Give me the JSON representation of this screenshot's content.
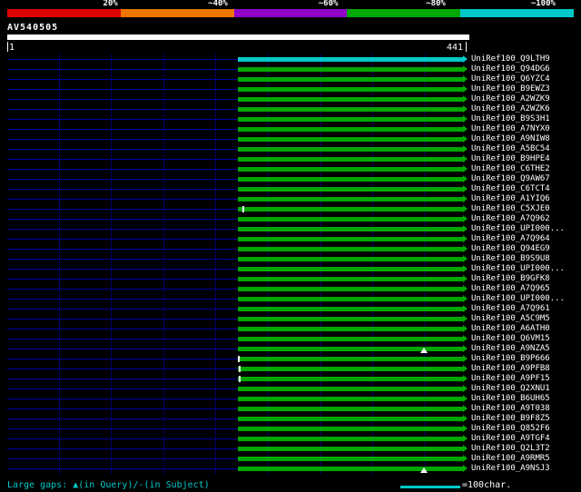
{
  "scale_bar": {
    "segments": [
      {
        "label": "20%",
        "color": "#dd0000"
      },
      {
        "label": "~40%",
        "color": "#ee7700"
      },
      {
        "label": "~60%",
        "color": "#9000c8"
      },
      {
        "label": "~80%",
        "color": "#00a800"
      },
      {
        "label": "~100%",
        "color": "#00c8c8"
      }
    ]
  },
  "query": {
    "name": "AV540505",
    "start_label": "1",
    "end_label": "441",
    "length": 441
  },
  "footer": {
    "legend": "Large gaps: ▲(in Query)/-(in Subject)",
    "scale_label": "=100char."
  },
  "chart_data": {
    "type": "bar",
    "orientation": "horizontal",
    "x_range": [
      1,
      441
    ],
    "x_start_label": "1",
    "x_end_label": "441",
    "query_name": "AV540505",
    "identity_legend": {
      "green": "~80%",
      "cyan": "~100%"
    },
    "hits": [
      {
        "name": "UniRef100_Q9LTH9",
        "start": 221,
        "end": 441,
        "color": "#00c8c8",
        "identity": "~100%"
      },
      {
        "name": "UniRef100_Q94DG6",
        "start": 221,
        "end": 441,
        "color": "#00a800",
        "identity": "~80%"
      },
      {
        "name": "UniRef100_Q6YZC4",
        "start": 221,
        "end": 441,
        "color": "#00a800",
        "identity": "~80%"
      },
      {
        "name": "UniRef100_B9EWZ3",
        "start": 221,
        "end": 441,
        "color": "#00a800",
        "identity": "~80%"
      },
      {
        "name": "UniRef100_A2WZK9",
        "start": 221,
        "end": 441,
        "color": "#00a800",
        "identity": "~80%"
      },
      {
        "name": "UniRef100_A2WZK6",
        "start": 221,
        "end": 441,
        "color": "#00a800",
        "identity": "~80%"
      },
      {
        "name": "UniRef100_B9S3H1",
        "start": 221,
        "end": 441,
        "color": "#00a800",
        "identity": "~80%"
      },
      {
        "name": "UniRef100_A7NYX0",
        "start": 221,
        "end": 441,
        "color": "#00a800",
        "identity": "~80%"
      },
      {
        "name": "UniRef100_A9NIW8",
        "start": 221,
        "end": 441,
        "color": "#00a800",
        "identity": "~80%"
      },
      {
        "name": "UniRef100_A5BC54",
        "start": 221,
        "end": 441,
        "color": "#00a800",
        "identity": "~80%"
      },
      {
        "name": "UniRef100_B9HPE4",
        "start": 221,
        "end": 441,
        "color": "#00a800",
        "identity": "~80%"
      },
      {
        "name": "UniRef100_C6THE2",
        "start": 221,
        "end": 441,
        "color": "#00a800",
        "identity": "~80%"
      },
      {
        "name": "UniRef100_Q9AW67",
        "start": 221,
        "end": 441,
        "color": "#00a800",
        "identity": "~80%"
      },
      {
        "name": "UniRef100_C6TCT4",
        "start": 221,
        "end": 441,
        "color": "#00a800",
        "identity": "~80%"
      },
      {
        "name": "UniRef100_A1YIQ6",
        "start": 221,
        "end": 441,
        "color": "#00a800",
        "identity": "~80%"
      },
      {
        "name": "UniRef100_C5XJE0",
        "start": 221,
        "end": 441,
        "color": "#00a800",
        "identity": "~80%",
        "markers": [
          {
            "type": "tick",
            "pos": 226
          }
        ]
      },
      {
        "name": "UniRef100_A7Q962",
        "start": 221,
        "end": 441,
        "color": "#00a800",
        "identity": "~80%"
      },
      {
        "name": "UniRef100_UPI000...",
        "start": 221,
        "end": 441,
        "color": "#00a800",
        "identity": "~80%"
      },
      {
        "name": "UniRef100_A7Q964",
        "start": 221,
        "end": 441,
        "color": "#00a800",
        "identity": "~80%"
      },
      {
        "name": "UniRef100_Q94EG9",
        "start": 221,
        "end": 441,
        "color": "#00a800",
        "identity": "~80%"
      },
      {
        "name": "UniRef100_B9S9U8",
        "start": 221,
        "end": 441,
        "color": "#00a800",
        "identity": "~80%"
      },
      {
        "name": "UniRef100_UPI000...",
        "start": 221,
        "end": 441,
        "color": "#00a800",
        "identity": "~80%"
      },
      {
        "name": "UniRef100_B9GFK8",
        "start": 221,
        "end": 441,
        "color": "#00a800",
        "identity": "~80%"
      },
      {
        "name": "UniRef100_A7Q965",
        "start": 221,
        "end": 441,
        "color": "#00a800",
        "identity": "~80%"
      },
      {
        "name": "UniRef100_UPI000...",
        "start": 221,
        "end": 441,
        "color": "#00a800",
        "identity": "~80%"
      },
      {
        "name": "UniRef100_A7Q961",
        "start": 221,
        "end": 441,
        "color": "#00a800",
        "identity": "~80%"
      },
      {
        "name": "UniRef100_A5C9M5",
        "start": 221,
        "end": 441,
        "color": "#00a800",
        "identity": "~80%"
      },
      {
        "name": "UniRef100_A6ATH0",
        "start": 221,
        "end": 441,
        "color": "#00a800",
        "identity": "~80%"
      },
      {
        "name": "UniRef100_Q6VM15",
        "start": 221,
        "end": 441,
        "color": "#00a800",
        "identity": "~80%"
      },
      {
        "name": "UniRef100_A9NZA5",
        "start": 221,
        "end": 441,
        "color": "#00a800",
        "identity": "~80%",
        "markers": [
          {
            "type": "gap-query",
            "pos": 399
          }
        ]
      },
      {
        "name": "UniRef100_B9P666",
        "start": 221,
        "end": 441,
        "color": "#00a800",
        "identity": "~80%",
        "markers": [
          {
            "type": "tick",
            "pos": 221
          }
        ]
      },
      {
        "name": "UniRef100_A9PFB8",
        "start": 221,
        "end": 441,
        "color": "#00a800",
        "identity": "~80%",
        "markers": [
          {
            "type": "tick",
            "pos": 222
          }
        ]
      },
      {
        "name": "UniRef100_A9PF15",
        "start": 221,
        "end": 441,
        "color": "#00a800",
        "identity": "~80%",
        "markers": [
          {
            "type": "tick",
            "pos": 222
          }
        ]
      },
      {
        "name": "UniRef100_Q2XNU1",
        "start": 221,
        "end": 441,
        "color": "#00a800",
        "identity": "~80%"
      },
      {
        "name": "UniRef100_B6UH65",
        "start": 221,
        "end": 441,
        "color": "#00a800",
        "identity": "~80%"
      },
      {
        "name": "UniRef100_A9T038",
        "start": 221,
        "end": 441,
        "color": "#00a800",
        "identity": "~80%"
      },
      {
        "name": "UniRef100_B9F8Z5",
        "start": 221,
        "end": 441,
        "color": "#00a800",
        "identity": "~80%"
      },
      {
        "name": "UniRef100_Q852F6",
        "start": 221,
        "end": 441,
        "color": "#00a800",
        "identity": "~80%"
      },
      {
        "name": "UniRef100_A9TGF4",
        "start": 221,
        "end": 441,
        "color": "#00a800",
        "identity": "~80%"
      },
      {
        "name": "UniRef100_Q2L3T2",
        "start": 221,
        "end": 441,
        "color": "#00a800",
        "identity": "~80%"
      },
      {
        "name": "UniRef100_A9RMR5",
        "start": 221,
        "end": 441,
        "color": "#00a800",
        "identity": "~80%"
      },
      {
        "name": "UniRef100_A9NSJ3",
        "start": 221,
        "end": 441,
        "color": "#00a800",
        "identity": "~80%",
        "markers": [
          {
            "type": "gap-query",
            "pos": 399
          }
        ]
      }
    ]
  }
}
